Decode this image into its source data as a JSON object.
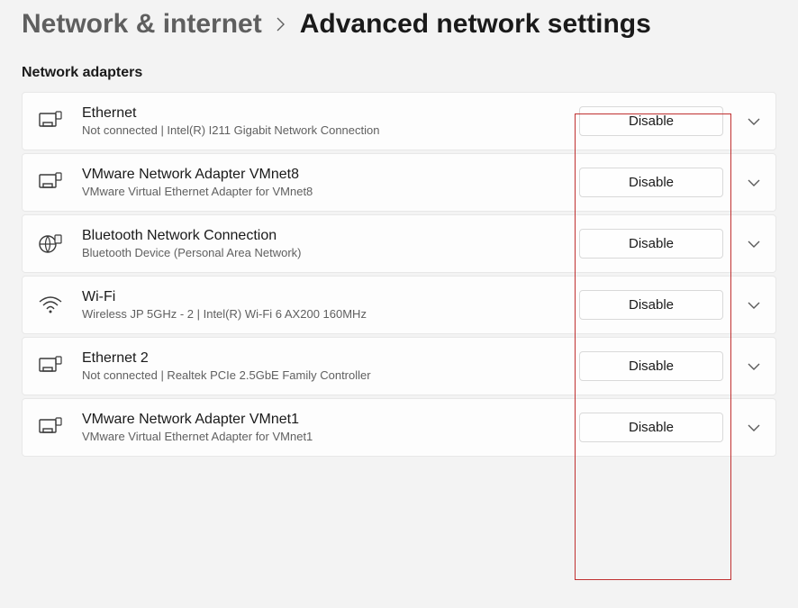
{
  "breadcrumb": {
    "parent": "Network & internet",
    "current": "Advanced network settings"
  },
  "section_heading": "Network adapters",
  "highlight": {
    "present": true,
    "color": "#c03030"
  },
  "adapters": [
    {
      "icon": "ethernet",
      "title": "Ethernet",
      "description": "Not connected | Intel(R) I211 Gigabit Network Connection",
      "button_label": "Disable"
    },
    {
      "icon": "ethernet",
      "title": "VMware Network Adapter VMnet8",
      "description": "VMware Virtual Ethernet Adapter for VMnet8",
      "button_label": "Disable"
    },
    {
      "icon": "bluetooth",
      "title": "Bluetooth Network Connection",
      "description": "Bluetooth Device (Personal Area Network)",
      "button_label": "Disable"
    },
    {
      "icon": "wifi",
      "title": "Wi-Fi",
      "description": "Wireless JP 5GHz - 2 | Intel(R) Wi-Fi 6 AX200 160MHz",
      "button_label": "Disable"
    },
    {
      "icon": "ethernet",
      "title": "Ethernet 2",
      "description": "Not connected | Realtek PCIe 2.5GbE Family Controller",
      "button_label": "Disable"
    },
    {
      "icon": "ethernet",
      "title": "VMware Network Adapter VMnet1",
      "description": "VMware Virtual Ethernet Adapter for VMnet1",
      "button_label": "Disable"
    }
  ]
}
